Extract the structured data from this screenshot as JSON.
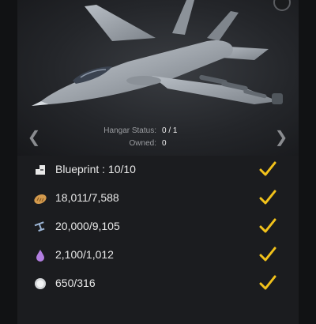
{
  "hangar": {
    "status_label": "Hangar Status:",
    "status_value": "0 / 1",
    "owned_label": "Owned:",
    "owned_value": "0"
  },
  "nav": {
    "prev_glyph": "❮",
    "next_glyph": "❯"
  },
  "requirements": [
    {
      "icon": "blueprint-icon",
      "text": "Blueprint : 10/10",
      "met": true
    },
    {
      "icon": "bread-food-icon",
      "text": "18,011/7,588",
      "met": true
    },
    {
      "icon": "steel-beam-icon",
      "text": "20,000/9,105",
      "met": true
    },
    {
      "icon": "oil-drop-icon",
      "text": "2,100/1,012",
      "met": true
    },
    {
      "icon": "silver-coin-icon",
      "text": "650/316",
      "met": true
    }
  ],
  "colors": {
    "check": "#f2c21b",
    "oil": "#b27ee0",
    "bread": "#d39a4d",
    "steel": "#9db6d6"
  }
}
